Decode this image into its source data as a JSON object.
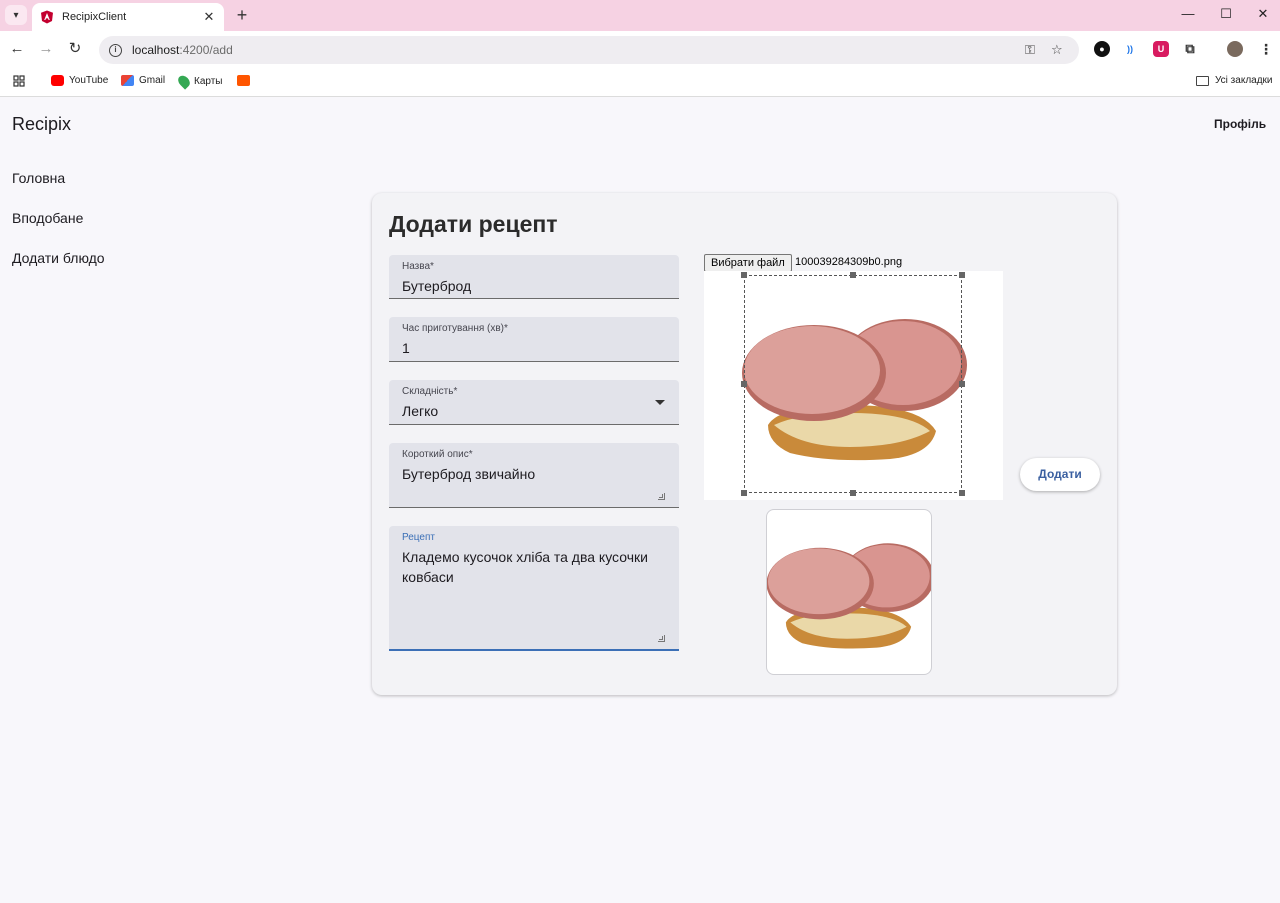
{
  "browser": {
    "tab_title": "RecipixClient",
    "url_host": "localhost",
    "url_path": ":4200/add",
    "bookmarks": [
      {
        "label": "YouTube",
        "icon": "youtube-icon",
        "color": "#ff0000"
      },
      {
        "label": "Gmail",
        "icon": "gmail-icon",
        "color": "#ea4335"
      },
      {
        "label": "Карты",
        "icon": "maps-icon",
        "color": "#34a853"
      },
      {
        "label": "",
        "icon": "soundcloud-icon",
        "color": "#ff5500"
      }
    ],
    "all_bookmarks_label": "Усі закладки"
  },
  "app": {
    "title": "Recipix",
    "profile_label": "Профіль",
    "sidebar": [
      {
        "label": "Головна"
      },
      {
        "label": "Вподобане"
      },
      {
        "label": "Додати блюдо"
      }
    ]
  },
  "form": {
    "title": "Додати рецепт",
    "name": {
      "label": "Назва*",
      "value": "Бутерброд"
    },
    "cook_time": {
      "label": "Час приготування (хв)*",
      "value": "1"
    },
    "difficulty": {
      "label": "Складність*",
      "value": "Легко"
    },
    "short_description": {
      "label": "Короткий опис*",
      "value": "Бутерброд звичайно"
    },
    "recipe": {
      "label": "Рецепт",
      "value": "Кладемо кусочок хліба та два кусочки ковбаси"
    },
    "file_button_label": "Вибрати файл",
    "file_name": "100039284309b0.png",
    "submit_label": "Додати"
  },
  "colors": {
    "accent": "#3b6fb6",
    "tabstrip": "#f6d2e3"
  }
}
